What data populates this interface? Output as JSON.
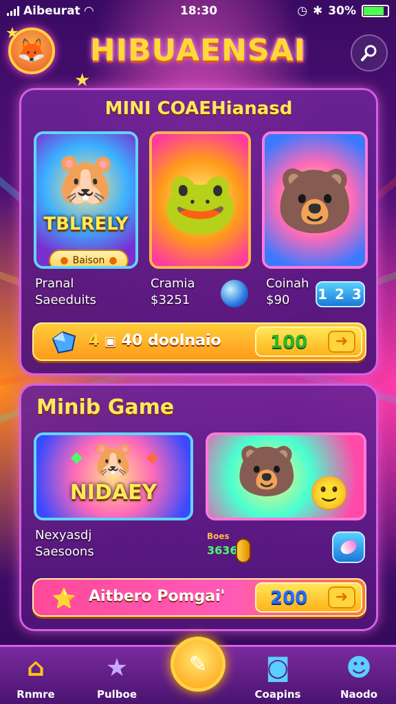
{
  "status": {
    "carrier": "Aibeurat",
    "time": "18:30",
    "battery": "30%"
  },
  "header": {
    "title": "HIBUAENSAI",
    "avatar_icon": "fox-avatar-icon",
    "search_icon": "search-icon"
  },
  "section1": {
    "title": "MINI COAEHianasd",
    "cards": [
      {
        "banner": "TBLRELY",
        "pill_label": "Baison",
        "name": "Pranal",
        "price": "Saeeduits"
      },
      {
        "name": "Cramia",
        "price": "$3251"
      },
      {
        "name": "Coinah",
        "price": "$90",
        "badge": "1 2 3"
      }
    ],
    "reward": {
      "label": "40 doolnaio",
      "value": "100",
      "prefix": "4"
    }
  },
  "section2": {
    "title": "Minib Game",
    "cards": [
      {
        "banner": "NIDAEY",
        "name": "Nexyasdj",
        "price": "Saesoons"
      },
      {
        "small_label": "Boes",
        "small_value": "3636"
      }
    ],
    "reward": {
      "label": "Aitbero Pomgai'",
      "value": "200"
    }
  },
  "nav": {
    "items": [
      {
        "label": "Rnmre",
        "icon": "home-icon"
      },
      {
        "label": "Pulboe",
        "icon": "star-icon"
      },
      {
        "label": "Coapins",
        "icon": "chat-icon"
      },
      {
        "label": "Naodo",
        "icon": "profile-icon"
      }
    ]
  },
  "colors": {
    "accent": "#ffd93b",
    "panel_border": "#d45fe6",
    "background": "#4a0f78"
  }
}
